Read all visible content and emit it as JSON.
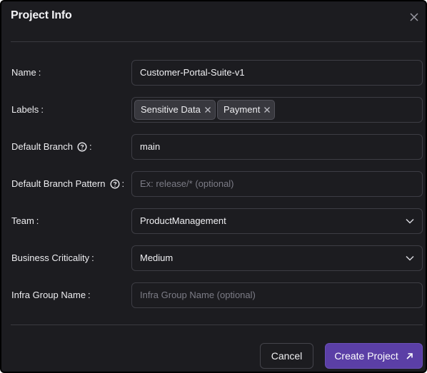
{
  "dialog": {
    "title": "Project Info",
    "close_icon": "close-icon"
  },
  "form": {
    "name": {
      "label": "Name",
      "value": "Customer-Portal-Suite-v1"
    },
    "labels": {
      "label": "Labels",
      "chips": [
        "Sensitive Data",
        "Payment"
      ]
    },
    "default_branch": {
      "label": "Default Branch",
      "value": "main",
      "help_icon": "help-circle-icon"
    },
    "default_branch_pattern": {
      "label": "Default Branch Pattern",
      "placeholder": "Ex: release/* (optional)",
      "help_icon": "help-circle-icon"
    },
    "team": {
      "label": "Team",
      "value": "ProductManagement"
    },
    "business_criticality": {
      "label": "Business Criticality",
      "value": "Medium"
    },
    "infra_group_name": {
      "label": "Infra Group Name",
      "placeholder": "Infra Group Name (optional)"
    },
    "colon": ":"
  },
  "actions": {
    "cancel_label": "Cancel",
    "create_label": "Create Project",
    "create_icon": "arrow-up-right-icon"
  },
  "colors": {
    "background": "#1c1c20",
    "accent": "#5b3fa6"
  }
}
